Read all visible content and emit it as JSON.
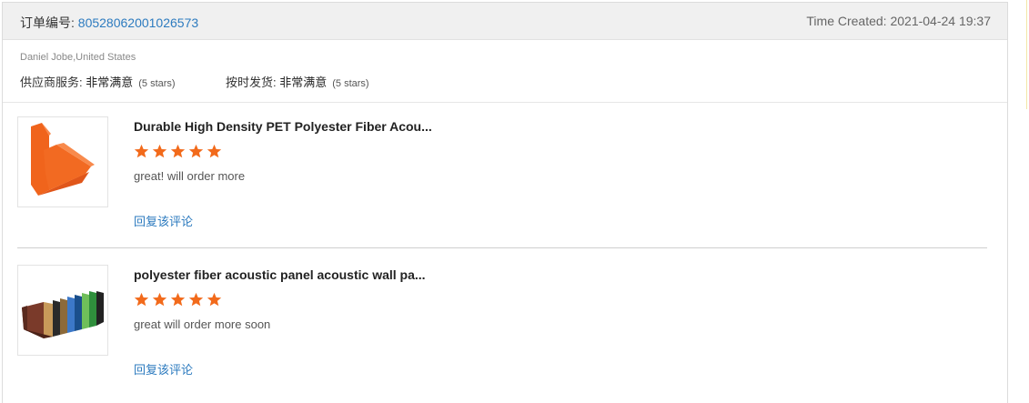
{
  "order": {
    "label": "订单编号: ",
    "number": "80528062001026573",
    "time_created": "Time Created: 2021-04-24 19:37"
  },
  "buyer": {
    "name_location": "Daniel Jobe,United States",
    "supplier_service": {
      "label": "供应商服务: ",
      "value": "非常满意",
      "stars": "(5 stars)"
    },
    "on_time_shipping": {
      "label": "按时发货: ",
      "value": "非常满意",
      "stars": "(5 stars)"
    }
  },
  "reviews": [
    {
      "title": "Durable High Density PET Polyester Fiber Acou...",
      "rating": 5,
      "comment": "great! will order more",
      "reply_label": "回复该评论",
      "thumbnail_icon": "orange-acoustic-panel-icon"
    },
    {
      "title": "polyester fiber acoustic panel acoustic wall pa...",
      "rating": 5,
      "comment": "great will order more soon",
      "reply_label": "回复该评论",
      "thumbnail_icon": "colorful-acoustic-panels-icon"
    }
  ],
  "colors": {
    "accent_link": "#2d7bbf",
    "star": "#f26a1b",
    "header_bg": "#f0f0f0"
  }
}
